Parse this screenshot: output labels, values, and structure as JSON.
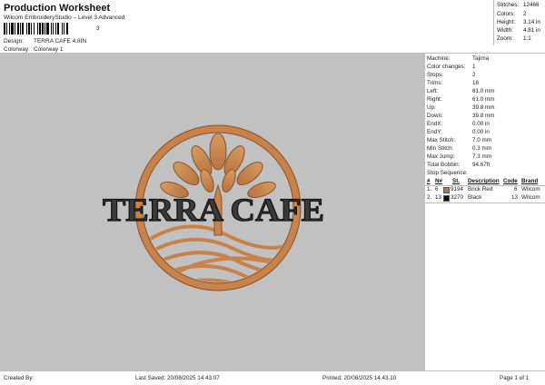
{
  "header": {
    "title": "Production Worksheet",
    "subtitle": "Wilcom EmbroideryStudio – Level 3 Advanced",
    "barcode_suffix": "3"
  },
  "meta": {
    "design_label": "Design:",
    "design_value": "TERRA CAFE 4.8IN",
    "colorway_label": "Colorway:",
    "colorway_value": "Colorway 1"
  },
  "stats": [
    {
      "label": "Stitches:",
      "value": "12466"
    },
    {
      "label": "Colors:",
      "value": "2"
    },
    {
      "label": "Height:",
      "value": "3.14 in"
    },
    {
      "label": "Width:",
      "value": "4.81 in"
    },
    {
      "label": "Zoom:",
      "value": "1:1"
    }
  ],
  "design": {
    "text": "TERRA CAFE",
    "colors": {
      "copper": "#c8824a",
      "copper_dark": "#8a5228",
      "black": "#3a3a38"
    }
  },
  "machine_info": [
    {
      "label": "Machine:",
      "value": "Tajima"
    },
    {
      "label": "Color changes:",
      "value": "1"
    },
    {
      "label": "Stops:",
      "value": "2"
    },
    {
      "label": "Trims:",
      "value": "18"
    },
    {
      "label": "Left:",
      "value": "61.0 mm"
    },
    {
      "label": "Right:",
      "value": "61.0 mm"
    },
    {
      "label": "Up:",
      "value": "39.8 mm"
    },
    {
      "label": "Down:",
      "value": "39.8 mm"
    },
    {
      "label": "EndX:",
      "value": "0.00 in"
    },
    {
      "label": "EndY:",
      "value": "0.00 in"
    },
    {
      "label": "Max Stitch:",
      "value": "7.0 mm"
    },
    {
      "label": "Min Stitch:",
      "value": "0.3 mm"
    },
    {
      "label": "Max Jump:",
      "value": "7.3 mm"
    },
    {
      "label": "Total Bobbin:",
      "value": "94.67ft"
    }
  ],
  "stop_sequence": {
    "title": "Stop Sequence:",
    "headers": {
      "num": "#",
      "n": "N#",
      "st": "St.",
      "desc": "Description",
      "code": "Code",
      "brand": "Brand"
    },
    "rows": [
      {
        "num": "1.",
        "n": "6",
        "st": "9194",
        "desc": "Brick Red",
        "code": "6",
        "brand": "Wilcom",
        "color": "#b5764a"
      },
      {
        "num": "2.",
        "n": "13",
        "st": "3270",
        "desc": "Black",
        "code": "13",
        "brand": "Wilcom",
        "color": "#111111"
      }
    ]
  },
  "footer": {
    "created_by": "Created By:",
    "last_saved": "Last Saved: 20/08/2025 14.43.07",
    "printed": "Printed: 20/08/2025 14.43.10",
    "page": "Page 1 of 1"
  }
}
